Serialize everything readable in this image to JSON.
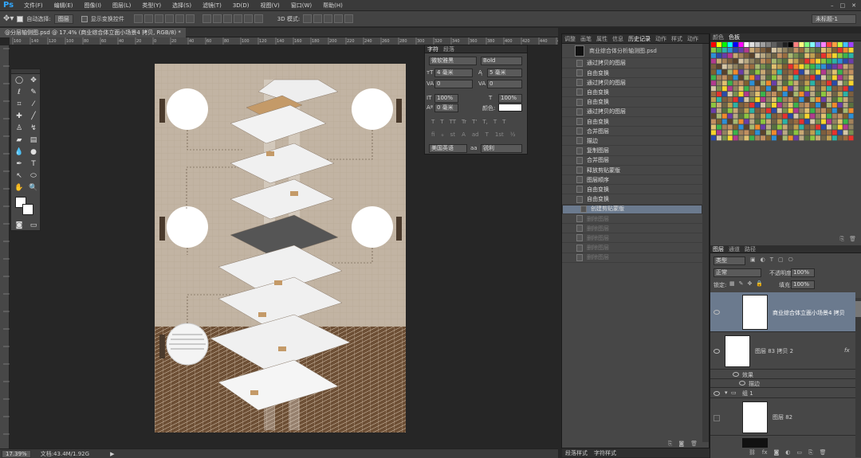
{
  "app": {
    "logo": "Ps"
  },
  "menu": [
    "文件(F)",
    "编辑(E)",
    "图像(I)",
    "图层(L)",
    "类型(Y)",
    "选择(S)",
    "滤镜(T)",
    "3D(D)",
    "视图(V)",
    "窗口(W)",
    "帮助(H)"
  ],
  "options_bar": {
    "auto_select_label": "自动选择:",
    "auto_select_target": "图层",
    "show_transform_label": "显示变换控件",
    "mode_3d_label": "3D 模式:",
    "workspace": "未标题-1"
  },
  "document": {
    "tab_title": "@分层轴侧图.psd @ 17.4% (商业综合体立面小场景4 拷贝, RGB/8) *",
    "zoom": "17.39%",
    "doc_size": "文档:43.4M/1.92G"
  },
  "ruler_top_ticks": [
    "160",
    "140",
    "120",
    "100",
    "80",
    "60",
    "40",
    "20",
    "0",
    "20",
    "40",
    "60",
    "80",
    "100",
    "120",
    "140",
    "160",
    "180",
    "200",
    "220",
    "240",
    "260",
    "280",
    "300",
    "320",
    "340",
    "360",
    "380",
    "400",
    "420",
    "440",
    "460"
  ],
  "character_panel": {
    "tabs": [
      "字符",
      "段落"
    ],
    "font_family": "微软雅黑",
    "font_style": "Bold",
    "font_size": "4 毫米",
    "leading": "5 毫米",
    "kerning": "0",
    "tracking": "0",
    "vscale": "100%",
    "hscale": "100%",
    "baseline": "0 毫米",
    "color_label": "颜色:",
    "type_buttons": [
      "T",
      "T",
      "TT",
      "Tr",
      "T'",
      "T,",
      "T",
      "T"
    ],
    "lang": "美国英语",
    "aa_label": "aa",
    "aa_value": "锐利"
  },
  "history_panel": {
    "tabs": [
      "调整",
      "画笔",
      "属性",
      "信息",
      "历史记录",
      "动作",
      "样式",
      "动作"
    ],
    "snapshot": "商业综合体分析轴测图.psd",
    "items": [
      {
        "label": "通过拷贝的图层",
        "state": "normal"
      },
      {
        "label": "自由变换",
        "state": "normal"
      },
      {
        "label": "通过拷贝的图层",
        "state": "normal"
      },
      {
        "label": "自由变换",
        "state": "normal"
      },
      {
        "label": "自由变换",
        "state": "normal"
      },
      {
        "label": "通过拷贝的图层",
        "state": "normal"
      },
      {
        "label": "自由变换",
        "state": "normal"
      },
      {
        "label": "合并图层",
        "state": "normal"
      },
      {
        "label": "描边",
        "state": "normal"
      },
      {
        "label": "复制图层",
        "state": "normal"
      },
      {
        "label": "合并图层",
        "state": "normal"
      },
      {
        "label": "释放剪贴蒙版",
        "state": "normal"
      },
      {
        "label": "图层顺序",
        "state": "normal"
      },
      {
        "label": "自由变换",
        "state": "normal"
      },
      {
        "label": "自由变换",
        "state": "normal"
      },
      {
        "label": "创建剪贴蒙版",
        "state": "selected"
      },
      {
        "label": "删除图层",
        "state": "dim"
      },
      {
        "label": "删除图层",
        "state": "dim"
      },
      {
        "label": "删除图层",
        "state": "dim"
      },
      {
        "label": "删除图层",
        "state": "dim"
      },
      {
        "label": "删除图层",
        "state": "dim"
      }
    ],
    "bottom_tabs": [
      "段落样式",
      "字符样式"
    ]
  },
  "swatches_panel": {
    "tabs": [
      "颜色",
      "色板"
    ]
  },
  "layers_panel": {
    "tabs": [
      "图层",
      "通道",
      "路径"
    ],
    "kind_filter": "类型",
    "blend_mode": "正常",
    "opacity_label": "不透明度:",
    "opacity": "100%",
    "lock_label": "锁定:",
    "fill_label": "填充:",
    "fill": "100%",
    "layers": [
      {
        "name": "商业综合体立面小场景4 拷贝",
        "selected": true
      },
      {
        "name": "图层 83 拷贝 2",
        "selected": false,
        "fx": "fx"
      },
      {
        "name": "效果",
        "type": "effect"
      },
      {
        "name": "描边",
        "type": "effect"
      },
      {
        "name": "组 1",
        "type": "group"
      },
      {
        "name": "图层 82",
        "selected": false
      }
    ]
  },
  "colors": {
    "canvas_bg": "#c2b4a3",
    "selection": "#6b7a8e",
    "panel": "#474747"
  }
}
